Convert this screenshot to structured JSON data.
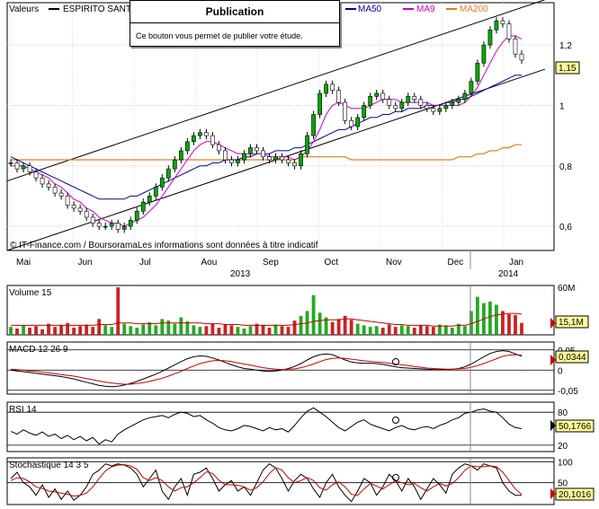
{
  "header": {
    "valeurs_label": "Valeurs",
    "ticker": "ESPIRITO SANT",
    "ma_hidden_fragment": "0",
    "ma50": "MA50",
    "ma9": "MA9",
    "ma200": "MA200",
    "colors": {
      "price": "#000000",
      "ma50": "#0000aa",
      "ma9": "#cc00cc",
      "ma200": "#e08020"
    }
  },
  "tooltip": {
    "title": "Publication",
    "text": "Ce bouton vous permet de publier votre étude."
  },
  "main_chart": {
    "copyright": "© IT-Finance.com / BoursoramaLes informations sont données à titre indicatif",
    "last_price_label": "1,15",
    "months": [
      "Mai",
      "Jun",
      "Jul",
      "Aou",
      "Sep",
      "Oct",
      "Nov",
      "Dec",
      "Jan"
    ],
    "years": [
      "2013",
      "2014"
    ]
  },
  "volume_panel": {
    "title": "Volume 15",
    "top_tick": "60M",
    "last_label": "15,1M"
  },
  "macd_panel": {
    "title": "MACD 12 26 9",
    "ticks": [
      "0,05",
      "0",
      "-0,05"
    ],
    "last_label": "0,0344"
  },
  "rsi_panel": {
    "title": "RSI 14",
    "ticks": [
      "80",
      "20"
    ],
    "last_label": "50,1766"
  },
  "stoch_panel": {
    "title": "Stochastique 14 3 5",
    "ticks": [
      "100",
      "50"
    ],
    "last_label": "20,1016"
  },
  "chart_data": [
    {
      "type": "candlestick",
      "title": "ESPIRITO SANT",
      "x_axis": [
        "Mai",
        "Jun",
        "Jul",
        "Aou",
        "Sep",
        "Oct",
        "Nov",
        "Dec",
        "Jan"
      ],
      "years": [
        "2013",
        "2014"
      ],
      "ylim": [
        0.52,
        1.34
      ],
      "yticks": [
        0.6,
        0.8,
        1,
        1.2
      ],
      "ytick_labels": [
        "0,6",
        "0,8",
        "1",
        "1,2"
      ],
      "close": [
        0.81,
        0.79,
        0.8,
        0.78,
        0.76,
        0.74,
        0.73,
        0.71,
        0.7,
        0.67,
        0.66,
        0.65,
        0.63,
        0.61,
        0.6,
        0.6,
        0.61,
        0.59,
        0.6,
        0.62,
        0.65,
        0.68,
        0.7,
        0.73,
        0.76,
        0.79,
        0.82,
        0.85,
        0.88,
        0.9,
        0.91,
        0.9,
        0.87,
        0.85,
        0.82,
        0.81,
        0.82,
        0.84,
        0.86,
        0.85,
        0.83,
        0.82,
        0.83,
        0.82,
        0.81,
        0.8,
        0.84,
        0.9,
        0.97,
        1.04,
        1.07,
        1.05,
        1.01,
        0.95,
        0.93,
        0.96,
        1.0,
        1.03,
        1.04,
        1.02,
        1.0,
        0.99,
        1.01,
        1.03,
        1.02,
        1.0,
        0.99,
        0.98,
        0.99,
        1.0,
        1.01,
        1.02,
        1.04,
        1.08,
        1.14,
        1.2,
        1.25,
        1.28,
        1.27,
        1.22,
        1.17,
        1.15
      ],
      "ma9": [
        0.8,
        0.8,
        0.8,
        0.79,
        0.78,
        0.77,
        0.76,
        0.74,
        0.73,
        0.71,
        0.69,
        0.68,
        0.66,
        0.65,
        0.63,
        0.62,
        0.61,
        0.61,
        0.6,
        0.61,
        0.62,
        0.63,
        0.65,
        0.67,
        0.7,
        0.73,
        0.76,
        0.79,
        0.82,
        0.85,
        0.87,
        0.88,
        0.88,
        0.87,
        0.86,
        0.85,
        0.84,
        0.84,
        0.84,
        0.84,
        0.84,
        0.83,
        0.83,
        0.83,
        0.83,
        0.82,
        0.83,
        0.85,
        0.88,
        0.92,
        0.97,
        1.0,
        1.01,
        1.0,
        0.99,
        0.99,
        0.99,
        1.0,
        1.01,
        1.02,
        1.02,
        1.02,
        1.01,
        1.01,
        1.01,
        1.01,
        1.01,
        1.0,
        1.0,
        1.0,
        1.0,
        1.0,
        1.01,
        1.03,
        1.06,
        1.1,
        1.14,
        1.18,
        1.21,
        1.23,
        1.23,
        1.22
      ],
      "ma50": [
        0.83,
        0.82,
        0.81,
        0.8,
        0.79,
        0.78,
        0.77,
        0.76,
        0.75,
        0.74,
        0.73,
        0.72,
        0.71,
        0.7,
        0.69,
        0.69,
        0.69,
        0.69,
        0.69,
        0.7,
        0.7,
        0.71,
        0.72,
        0.73,
        0.74,
        0.75,
        0.76,
        0.77,
        0.78,
        0.79,
        0.8,
        0.8,
        0.81,
        0.81,
        0.82,
        0.82,
        0.82,
        0.83,
        0.83,
        0.84,
        0.84,
        0.84,
        0.85,
        0.85,
        0.85,
        0.86,
        0.86,
        0.87,
        0.88,
        0.89,
        0.9,
        0.91,
        0.92,
        0.92,
        0.93,
        0.94,
        0.95,
        0.96,
        0.96,
        0.97,
        0.97,
        0.98,
        0.98,
        0.99,
        0.99,
        0.99,
        1.0,
        1.0,
        1.0,
        1.01,
        1.01,
        1.02,
        1.02,
        1.03,
        1.04,
        1.05,
        1.06,
        1.07,
        1.08,
        1.09,
        1.1,
        1.1
      ],
      "ma200": [
        0.82,
        0.82,
        0.82,
        0.82,
        0.82,
        0.82,
        0.82,
        0.82,
        0.82,
        0.82,
        0.82,
        0.82,
        0.82,
        0.82,
        0.82,
        0.82,
        0.82,
        0.82,
        0.82,
        0.82,
        0.82,
        0.82,
        0.82,
        0.82,
        0.82,
        0.82,
        0.82,
        0.82,
        0.82,
        0.82,
        0.82,
        0.82,
        0.82,
        0.82,
        0.82,
        0.82,
        0.82,
        0.82,
        0.82,
        0.82,
        0.82,
        0.82,
        0.82,
        0.82,
        0.82,
        0.82,
        0.83,
        0.83,
        0.83,
        0.83,
        0.83,
        0.83,
        0.83,
        0.83,
        0.82,
        0.82,
        0.82,
        0.82,
        0.82,
        0.82,
        0.82,
        0.82,
        0.82,
        0.82,
        0.82,
        0.82,
        0.82,
        0.82,
        0.82,
        0.82,
        0.82,
        0.83,
        0.83,
        0.83,
        0.84,
        0.84,
        0.85,
        0.85,
        0.86,
        0.86,
        0.87,
        0.87
      ],
      "trend_channel": [
        {
          "x0": 0,
          "y0": 0.75,
          "x1": 81,
          "y1": 1.35
        },
        {
          "x0": 0,
          "y0": 0.52,
          "x1": 81,
          "y1": 1.12
        }
      ],
      "last_value": 1.15
    },
    {
      "type": "bar",
      "title": "Volume 15",
      "unit": "M",
      "ylim": [
        0,
        60
      ],
      "values": [
        10,
        8,
        12,
        9,
        11,
        7,
        14,
        10,
        12,
        15,
        9,
        11,
        13,
        10,
        20,
        12,
        10,
        60,
        14,
        11,
        9,
        13,
        16,
        12,
        20,
        18,
        14,
        22,
        17,
        12,
        10,
        11,
        14,
        9,
        13,
        12,
        10,
        8,
        11,
        14,
        12,
        9,
        13,
        11,
        10,
        18,
        24,
        30,
        50,
        28,
        22,
        16,
        20,
        24,
        19,
        14,
        12,
        10,
        11,
        9,
        13,
        10,
        12,
        11,
        9,
        12,
        11,
        10,
        13,
        12,
        9,
        14,
        11,
        30,
        48,
        40,
        42,
        38,
        30,
        26,
        25,
        15.1
      ],
      "direction": [
        1,
        0,
        1,
        0,
        0,
        0,
        0,
        0,
        0,
        0,
        0,
        0,
        0,
        0,
        0,
        1,
        1,
        0,
        1,
        1,
        1,
        1,
        1,
        1,
        1,
        1,
        1,
        1,
        1,
        1,
        1,
        0,
        0,
        0,
        0,
        0,
        1,
        1,
        1,
        0,
        0,
        0,
        1,
        0,
        0,
        0,
        1,
        1,
        1,
        1,
        1,
        0,
        0,
        0,
        0,
        1,
        1,
        1,
        1,
        0,
        0,
        0,
        1,
        1,
        0,
        0,
        0,
        0,
        1,
        1,
        1,
        1,
        1,
        1,
        1,
        1,
        1,
        1,
        0,
        0,
        0,
        0
      ],
      "average": [
        12,
        12,
        12,
        12,
        12,
        12,
        12,
        12,
        12,
        12,
        12,
        12,
        12,
        12,
        13,
        13,
        13,
        15,
        15,
        15,
        14,
        14,
        14,
        14,
        15,
        15,
        15,
        15,
        15,
        15,
        15,
        14,
        14,
        14,
        13,
        13,
        13,
        12,
        12,
        12,
        12,
        12,
        12,
        12,
        12,
        13,
        14,
        15,
        17,
        18,
        19,
        19,
        19,
        20,
        20,
        19,
        18,
        17,
        16,
        15,
        14,
        13,
        13,
        12,
        12,
        12,
        12,
        11,
        11,
        11,
        11,
        12,
        12,
        14,
        17,
        20,
        23,
        25,
        26,
        27,
        27,
        26
      ],
      "last_value": 15.1
    },
    {
      "type": "line",
      "title": "MACD 12 26 9",
      "ylim": [
        -0.055,
        0.065
      ],
      "yticks": [
        0.05,
        0,
        -0.05
      ],
      "series": [
        {
          "name": "MACD",
          "values": [
            0.0,
            -0.002,
            -0.004,
            -0.006,
            -0.008,
            -0.01,
            -0.012,
            -0.014,
            -0.016,
            -0.019,
            -0.022,
            -0.026,
            -0.03,
            -0.034,
            -0.038,
            -0.04,
            -0.041,
            -0.04,
            -0.037,
            -0.033,
            -0.028,
            -0.022,
            -0.016,
            -0.01,
            -0.003,
            0.005,
            0.013,
            0.021,
            0.028,
            0.033,
            0.035,
            0.034,
            0.03,
            0.025,
            0.019,
            0.013,
            0.008,
            0.004,
            0.002,
            0.0,
            -0.002,
            -0.003,
            -0.002,
            0.0,
            0.004,
            0.009,
            0.016,
            0.025,
            0.033,
            0.038,
            0.04,
            0.038,
            0.032,
            0.025,
            0.02,
            0.018,
            0.017,
            0.017,
            0.016,
            0.014,
            0.011,
            0.008,
            0.006,
            0.005,
            0.004,
            0.003,
            0.002,
            0.001,
            0.001,
            0.001,
            0.002,
            0.004,
            0.008,
            0.015,
            0.024,
            0.033,
            0.041,
            0.046,
            0.048,
            0.046,
            0.04,
            0.034
          ]
        },
        {
          "name": "Signal",
          "values": [
            0.002,
            0.001,
            0.0,
            -0.002,
            -0.003,
            -0.005,
            -0.007,
            -0.009,
            -0.011,
            -0.013,
            -0.015,
            -0.018,
            -0.021,
            -0.024,
            -0.027,
            -0.03,
            -0.032,
            -0.034,
            -0.035,
            -0.035,
            -0.033,
            -0.031,
            -0.028,
            -0.024,
            -0.02,
            -0.015,
            -0.009,
            -0.003,
            0.004,
            0.01,
            0.016,
            0.02,
            0.023,
            0.024,
            0.023,
            0.021,
            0.018,
            0.015,
            0.012,
            0.009,
            0.006,
            0.004,
            0.002,
            0.001,
            0.002,
            0.003,
            0.006,
            0.01,
            0.015,
            0.021,
            0.026,
            0.029,
            0.03,
            0.029,
            0.027,
            0.025,
            0.023,
            0.021,
            0.02,
            0.019,
            0.017,
            0.015,
            0.013,
            0.011,
            0.009,
            0.007,
            0.005,
            0.004,
            0.003,
            0.002,
            0.002,
            0.003,
            0.004,
            0.007,
            0.011,
            0.016,
            0.022,
            0.028,
            0.034,
            0.037,
            0.038,
            0.037
          ]
        }
      ],
      "last_value": 0.0344
    },
    {
      "type": "line",
      "title": "RSI 14",
      "ylim": [
        10,
        95
      ],
      "yticks": [
        80,
        20
      ],
      "series": [
        {
          "name": "RSI",
          "values": [
            45,
            40,
            48,
            42,
            38,
            44,
            36,
            40,
            32,
            38,
            30,
            36,
            28,
            34,
            22,
            30,
            26,
            40,
            48,
            54,
            60,
            66,
            70,
            72,
            74,
            70,
            76,
            80,
            78,
            72,
            74,
            66,
            60,
            52,
            48,
            46,
            50,
            56,
            54,
            50,
            46,
            52,
            48,
            50,
            44,
            56,
            70,
            82,
            88,
            80,
            72,
            62,
            52,
            46,
            54,
            62,
            66,
            58,
            54,
            50,
            46,
            52,
            56,
            50,
            48,
            52,
            54,
            50,
            56,
            60,
            66,
            70,
            78,
            80,
            84,
            86,
            82,
            80,
            70,
            58,
            52,
            50
          ]
        }
      ],
      "last_value": 50.1766
    },
    {
      "type": "line",
      "title": "Stochastique 14 3 5",
      "ylim": [
        0,
        105
      ],
      "yticks": [
        100,
        50
      ],
      "series": [
        {
          "name": "%K",
          "values": [
            60,
            75,
            50,
            40,
            20,
            45,
            15,
            35,
            10,
            30,
            8,
            20,
            40,
            70,
            80,
            95,
            90,
            95,
            92,
            85,
            70,
            40,
            60,
            80,
            30,
            10,
            40,
            60,
            20,
            70,
            75,
            85,
            60,
            30,
            45,
            55,
            30,
            40,
            20,
            50,
            80,
            95,
            85,
            60,
            30,
            55,
            70,
            60,
            35,
            15,
            50,
            70,
            40,
            20,
            5,
            30,
            60,
            50,
            20,
            40,
            70,
            55,
            30,
            60,
            40,
            10,
            35,
            60,
            45,
            25,
            70,
            85,
            95,
            90,
            80,
            95,
            90,
            85,
            50,
            30,
            20,
            20
          ]
        },
        {
          "name": "%D",
          "values": [
            55,
            62,
            60,
            52,
            40,
            36,
            30,
            28,
            25,
            22,
            18,
            20,
            25,
            40,
            60,
            78,
            88,
            92,
            93,
            90,
            82,
            62,
            55,
            62,
            55,
            40,
            30,
            38,
            40,
            50,
            62,
            76,
            72,
            56,
            45,
            45,
            44,
            40,
            32,
            38,
            52,
            72,
            86,
            80,
            62,
            50,
            55,
            62,
            55,
            38,
            32,
            45,
            52,
            40,
            22,
            20,
            35,
            48,
            42,
            35,
            45,
            55,
            50,
            45,
            48,
            38,
            30,
            40,
            48,
            42,
            48,
            62,
            80,
            90,
            88,
            88,
            90,
            88,
            75,
            55,
            35,
            22
          ]
        }
      ],
      "last_value": 20.1016
    }
  ]
}
